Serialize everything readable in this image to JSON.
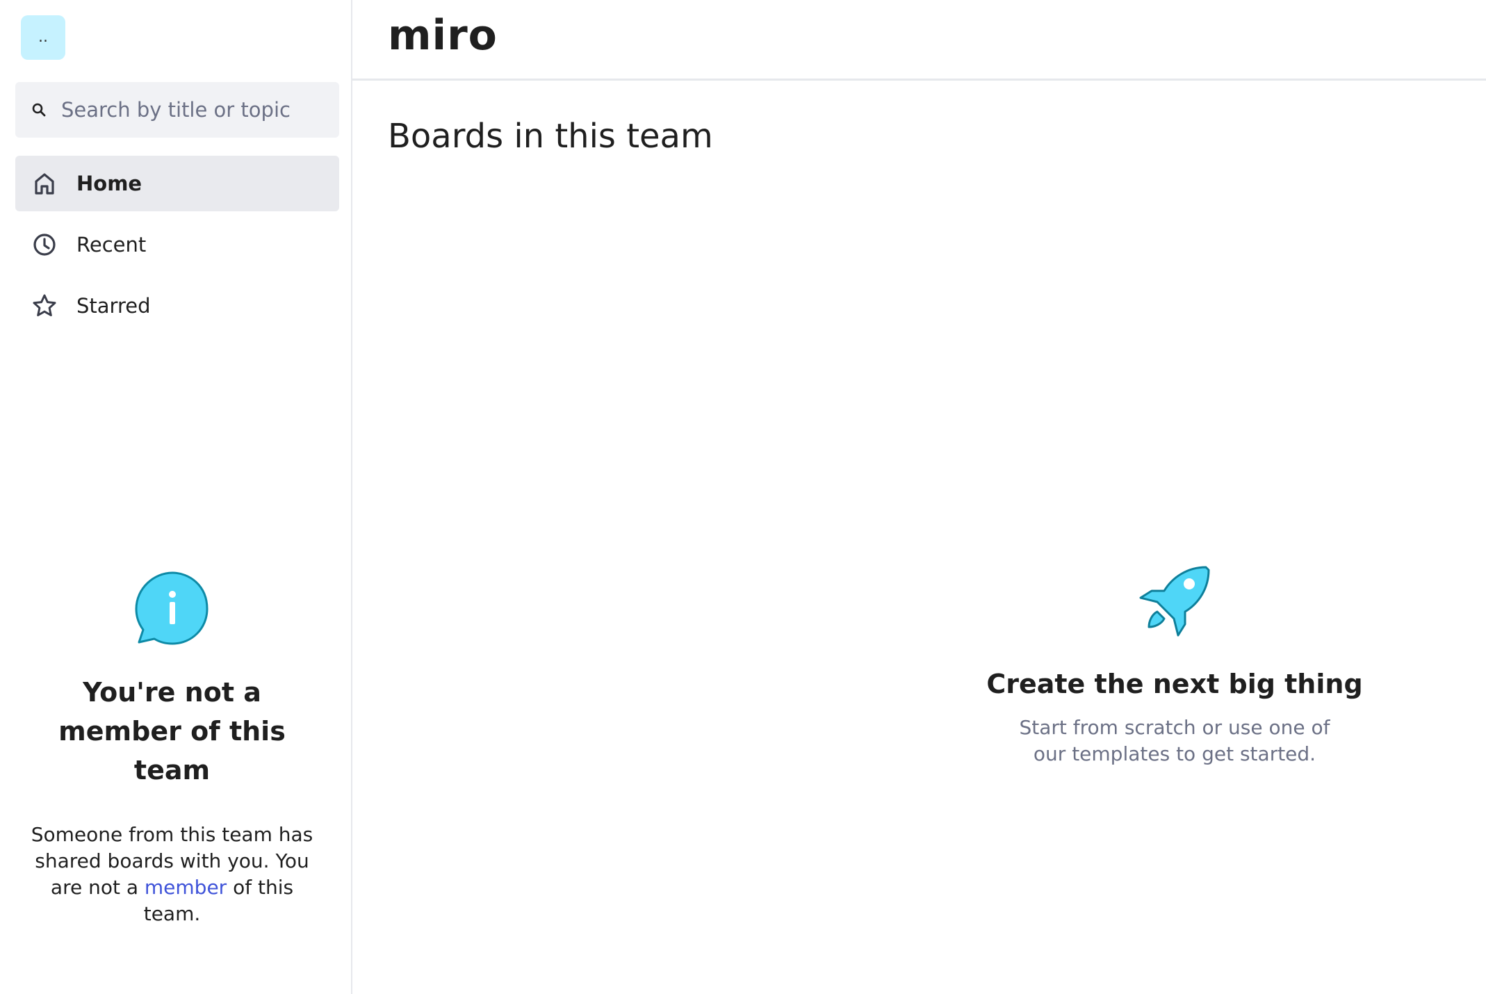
{
  "sidebar": {
    "team_avatar": "..",
    "search": {
      "placeholder": "Search by title or topic",
      "value": ""
    },
    "items": [
      {
        "label": "Home",
        "icon": "home-icon",
        "active": true
      },
      {
        "label": "Recent",
        "icon": "clock-icon",
        "active": false
      },
      {
        "label": "Starred",
        "icon": "star-icon",
        "active": false
      }
    ],
    "notice": {
      "icon": "info-bubble-icon",
      "title": "You're not a member of this team",
      "text_before": "Someone from this team has shared boards with you. You are not a ",
      "link": "member",
      "text_after": " of this team."
    }
  },
  "header": {
    "logo": "miro"
  },
  "main": {
    "title": "Boards in this team",
    "empty_state": {
      "icon": "rocket-icon",
      "title": "Create the next big thing",
      "text": "Start from scratch or use one of our templates to get started."
    }
  },
  "colors": {
    "accent_cyan": "#4fd6f7",
    "link": "#3f53d9",
    "active_bg": "#e9eaee",
    "avatar_bg": "#c6f2ff"
  }
}
